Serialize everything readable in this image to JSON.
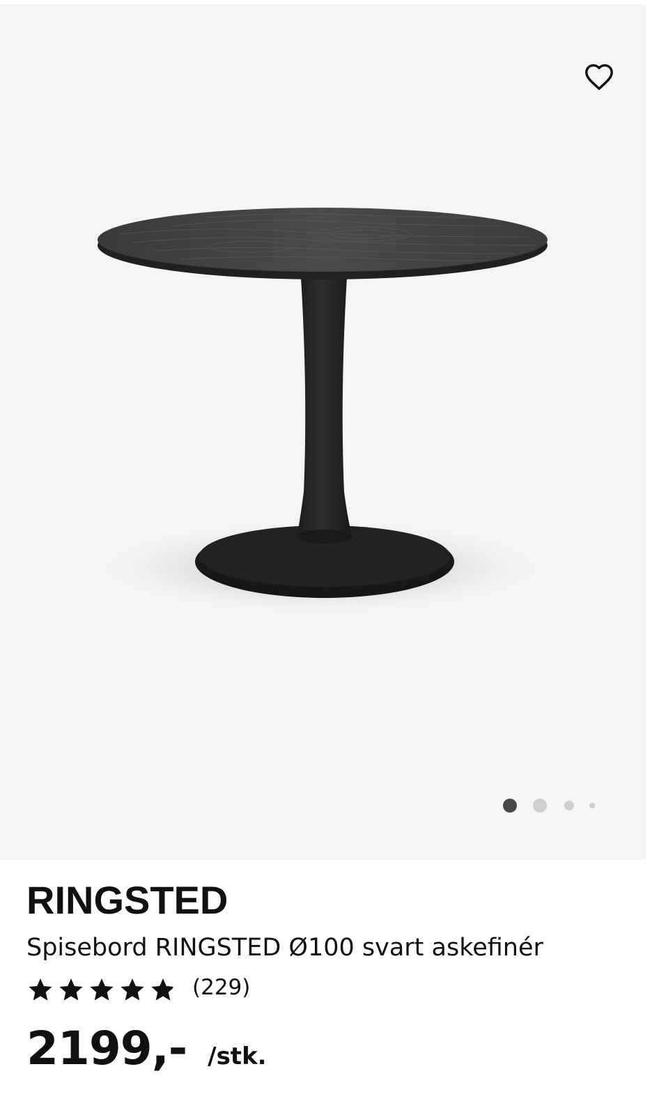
{
  "product": {
    "name": "RINGSTED",
    "description": "Spisebord RINGSTED Ø100 svart askefinér",
    "rating": {
      "stars_filled": 4.7,
      "stars_total": 5,
      "review_count": "(229)"
    },
    "price": "2199,-",
    "unit": "/stk."
  },
  "gallery": {
    "favorite_icon": "heart-outline-icon",
    "image_count": 4,
    "active_index": 0
  },
  "colors": {
    "image_background": "#f5f5f5",
    "dot_active": "#484848",
    "dot_inactive": "#cfcfcf",
    "text": "#111111"
  }
}
